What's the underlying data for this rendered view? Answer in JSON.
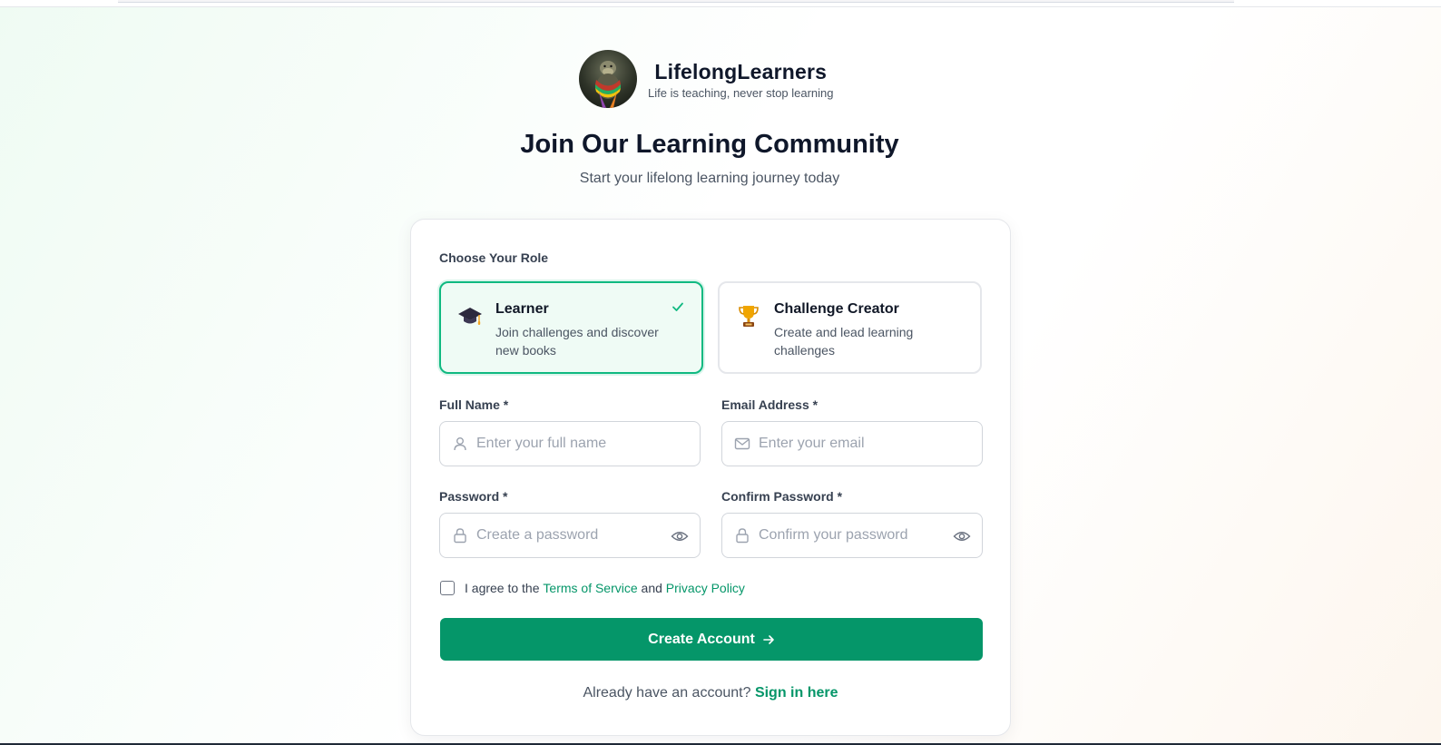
{
  "brand": {
    "name": "LifelongLearners",
    "tagline": "Life is teaching, never stop learning"
  },
  "page": {
    "title": "Join Our Learning Community",
    "subtitle": "Start your lifelong learning journey today"
  },
  "role_section": {
    "label": "Choose Your Role",
    "selected": "learner",
    "options": [
      {
        "id": "learner",
        "icon": "graduation-cap-icon",
        "title": "Learner",
        "description": "Join challenges and discover new books"
      },
      {
        "id": "challenge-creator",
        "icon": "trophy-icon",
        "title": "Challenge Creator",
        "description": "Create and lead learning challenges"
      }
    ]
  },
  "form": {
    "full_name": {
      "label": "Full Name *",
      "placeholder": "Enter your full name",
      "value": "",
      "icon": "user-icon"
    },
    "email": {
      "label": "Email Address *",
      "placeholder": "Enter your email",
      "value": "",
      "icon": "mail-icon"
    },
    "password": {
      "label": "Password *",
      "placeholder": "Create a password",
      "value": "",
      "icon": "lock-icon"
    },
    "confirm_password": {
      "label": "Confirm Password *",
      "placeholder": "Confirm your password",
      "value": "",
      "icon": "lock-icon"
    }
  },
  "agreement": {
    "prefix": "I agree to the",
    "terms": "Terms of Service",
    "and": "and",
    "privacy": "Privacy Policy",
    "checked": false
  },
  "submit": {
    "label": "Create Account"
  },
  "signin": {
    "prompt": "Already have an account?",
    "link": "Sign in here"
  },
  "colors": {
    "accent": "#059669",
    "selected_border": "#10b981",
    "selected_bg": "#effbf5",
    "heading": "#0f172a"
  }
}
